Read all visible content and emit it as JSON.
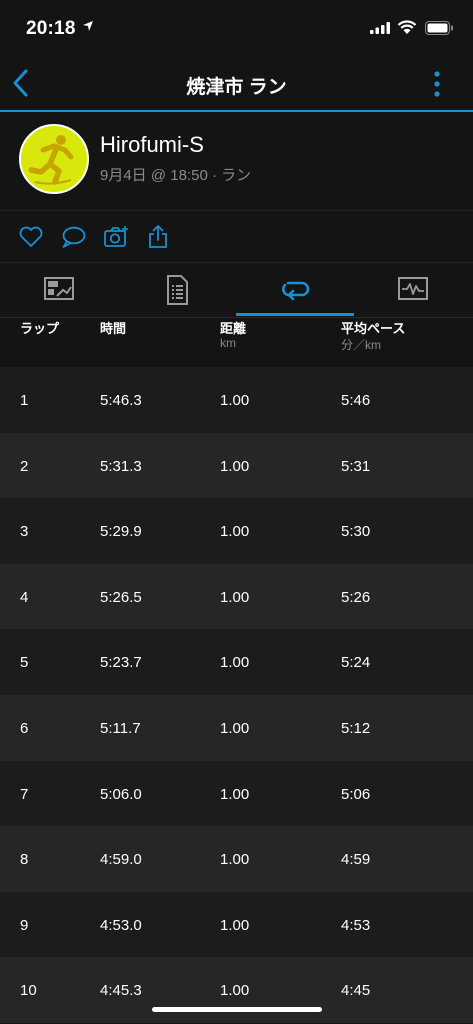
{
  "status": {
    "time": "20:18"
  },
  "nav": {
    "title": "焼津市 ラン"
  },
  "activity": {
    "user": "Hirofumi-S",
    "meta": "9月4日 @ 18:50 · ラン"
  },
  "actions": [
    "heart-icon",
    "comment-icon",
    "camera-icon",
    "share-icon"
  ],
  "tabs": [
    {
      "name": "summary-tab",
      "icon": "map-chart-icon"
    },
    {
      "name": "details-tab",
      "icon": "document-icon"
    },
    {
      "name": "laps-tab",
      "icon": "laps-icon",
      "active": true
    },
    {
      "name": "charts-tab",
      "icon": "graph-icon"
    }
  ],
  "table": {
    "headers": [
      {
        "label": "ラップ",
        "unit": ""
      },
      {
        "label": "時間",
        "unit": ""
      },
      {
        "label": "距離",
        "unit": "km"
      },
      {
        "label": "平均ペース",
        "unit": "分／km"
      }
    ],
    "rows": [
      [
        "1",
        "5:46.3",
        "1.00",
        "5:46"
      ],
      [
        "2",
        "5:31.3",
        "1.00",
        "5:31"
      ],
      [
        "3",
        "5:29.9",
        "1.00",
        "5:30"
      ],
      [
        "4",
        "5:26.5",
        "1.00",
        "5:26"
      ],
      [
        "5",
        "5:23.7",
        "1.00",
        "5:24"
      ],
      [
        "6",
        "5:11.7",
        "1.00",
        "5:12"
      ],
      [
        "7",
        "5:06.0",
        "1.00",
        "5:06"
      ],
      [
        "8",
        "4:59.0",
        "1.00",
        "4:59"
      ],
      [
        "9",
        "4:53.0",
        "1.00",
        "4:53"
      ],
      [
        "10",
        "4:45.3",
        "1.00",
        "4:45"
      ]
    ]
  },
  "colors": {
    "accent": "#1a8fd1",
    "avatar_bg": "#d8e80c",
    "background": "#141414"
  }
}
